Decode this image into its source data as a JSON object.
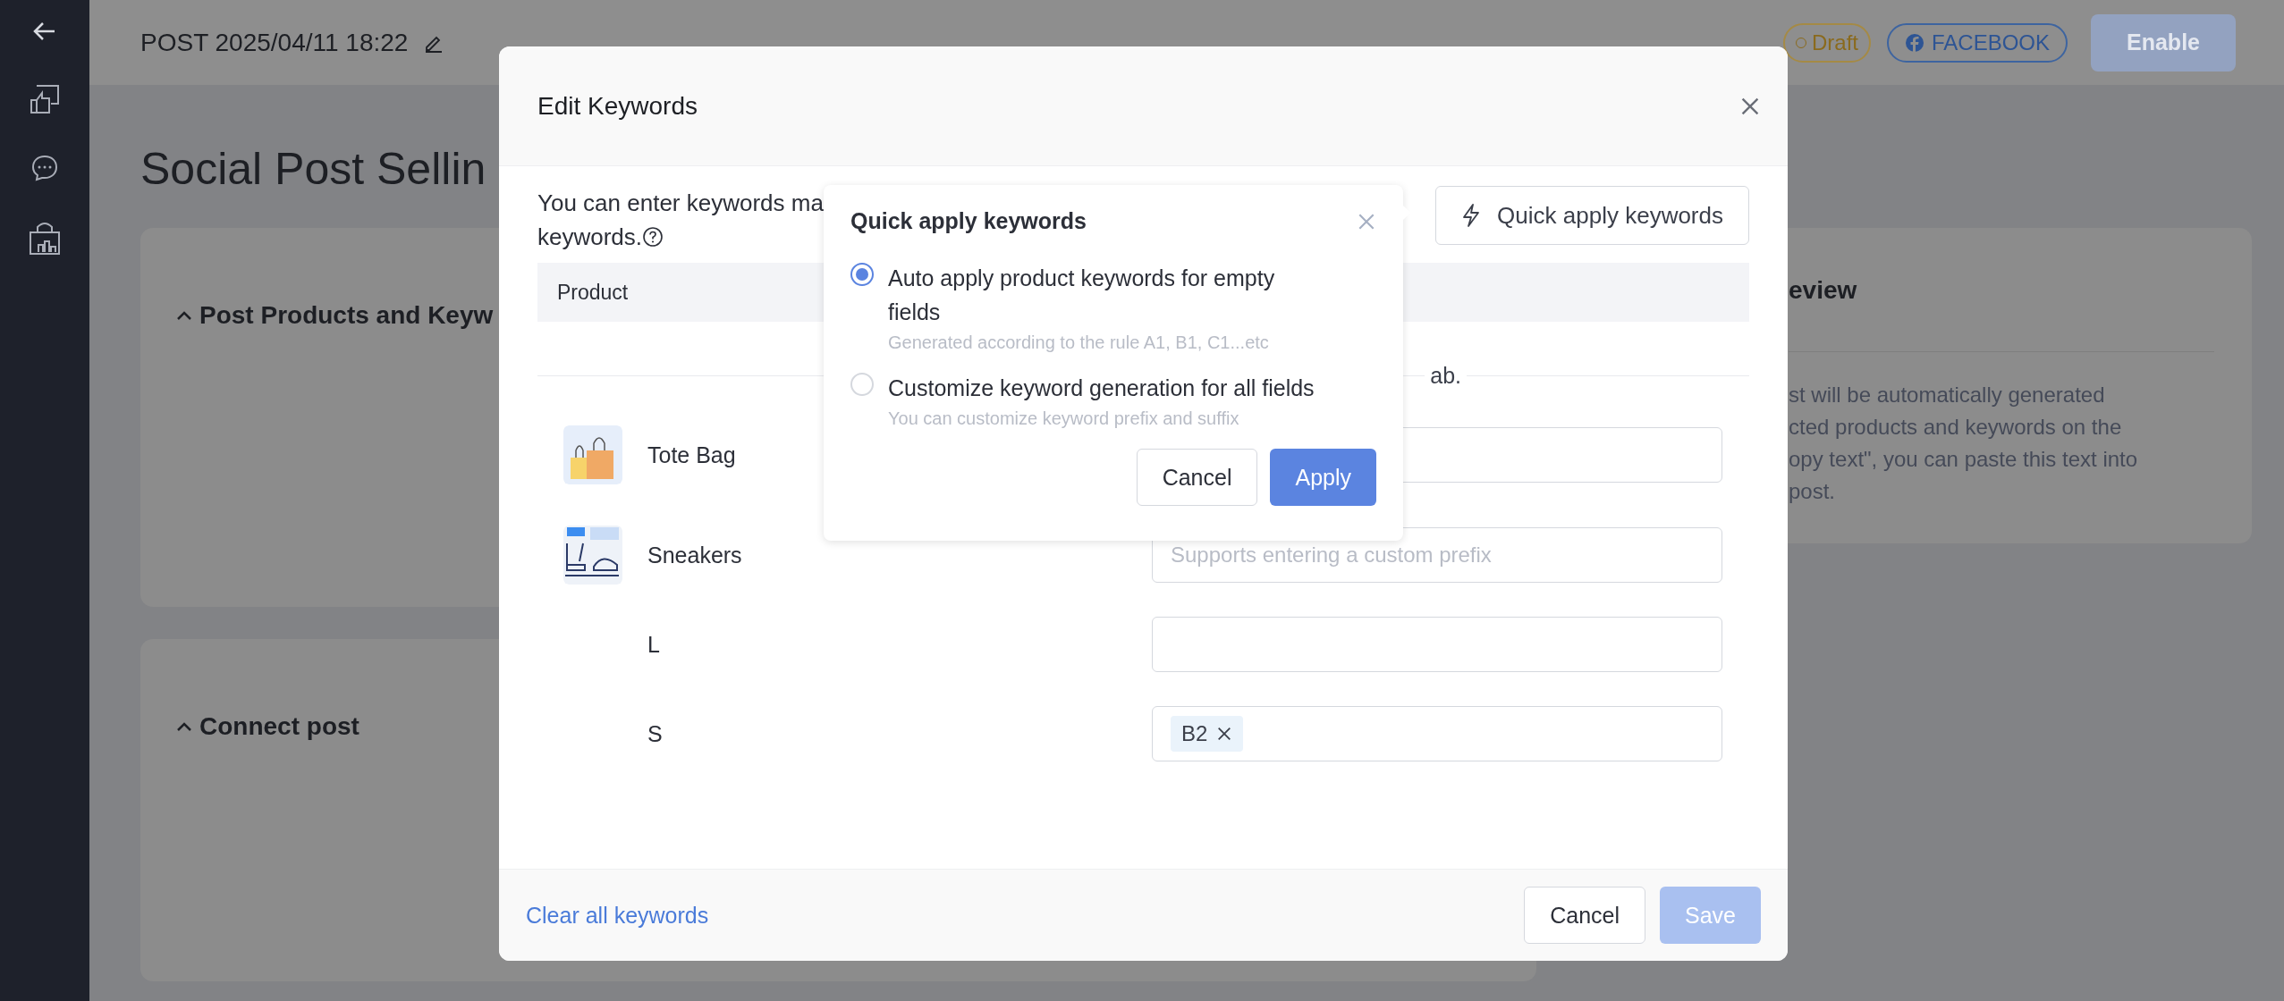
{
  "header": {
    "title": "POST 2025/04/11 18:22",
    "status": "Draft",
    "channel": "FACEBOOK",
    "enable_button": {
      "label": "Enable",
      "disabled": true
    }
  },
  "page": {
    "title": "Social Post Sellin",
    "cards": [
      {
        "title": "Post Products and Keyw",
        "expanded": true
      },
      {
        "title": "Connect post",
        "expanded": true
      }
    ],
    "preview": {
      "title": "eview",
      "lines": [
        "st will be automatically generated",
        "cted products and keywords on the",
        "opy text\", you can paste this text into",
        "post."
      ]
    }
  },
  "modal": {
    "title": "Edit Keywords",
    "intro": [
      "You can enter keywords ma",
      "keywords."
    ],
    "quick_apply_button": "Quick apply keywords",
    "table": {
      "columns": [
        "Product"
      ]
    },
    "note": "ab.",
    "rows": [
      {
        "kind": "product",
        "name": "Tote Bag"
      },
      {
        "kind": "product",
        "name": "Sneakers",
        "placeholder": "Supports entering a custom prefix"
      },
      {
        "kind": "variant",
        "name": "L"
      },
      {
        "kind": "variant",
        "name": "S",
        "tags": [
          "B2"
        ]
      }
    ],
    "clear_link": "Clear all keywords",
    "cancel_button": "Cancel",
    "save_button": {
      "label": "Save",
      "disabled": true
    }
  },
  "popover": {
    "title": "Quick apply keywords",
    "options": [
      {
        "label": "Auto apply product keywords for empty fields",
        "hint": "Generated according to the rule A1, B1, C1...etc",
        "selected": true
      },
      {
        "label": "Customize keyword generation for all fields",
        "hint": "You can customize keyword prefix and suffix",
        "selected": false
      }
    ],
    "cancel_button": "Cancel",
    "apply_button": "Apply"
  }
}
